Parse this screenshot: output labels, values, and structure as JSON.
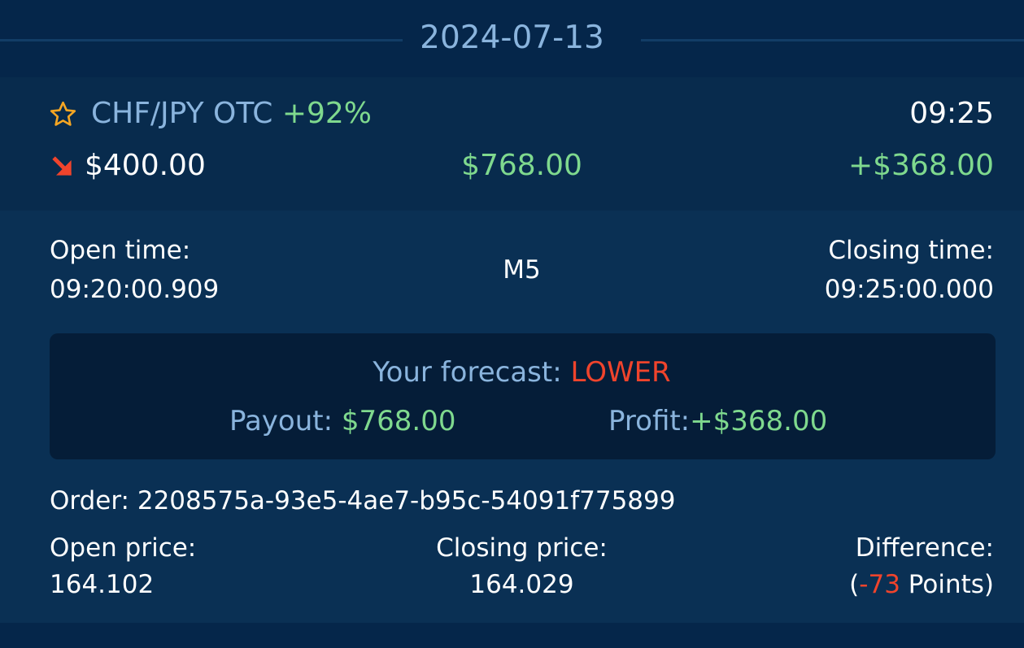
{
  "date_header": {
    "date": "2024-07-13"
  },
  "trade": {
    "asset": "CHF/JPY OTC",
    "payout_percent": "+92%",
    "close_hhmm": "09:25",
    "amount": "$400.00",
    "payout": "$768.00",
    "profit": "+$368.00",
    "direction_icon": "arrow-down-right-icon",
    "favorite_icon": "star-outline-icon"
  },
  "details": {
    "open_time_label": "Open time:",
    "open_time_value": "09:20:00.909",
    "timeframe": "M5",
    "closing_time_label": "Closing time:",
    "closing_time_value": "09:25:00.000",
    "forecast_label": "Your forecast:",
    "forecast_direction": "LOWER",
    "payout_label": "Payout:",
    "payout_value": "$768.00",
    "profit_label": "Profit:",
    "profit_value": "+$368.00",
    "order_label": "Order:",
    "order_id": "2208575a-93e5-4ae7-b95c-54091f775899",
    "open_price_label": "Open price:",
    "open_price_value": "164.102",
    "closing_price_label": "Closing price:",
    "closing_price_value": "164.029",
    "difference_label": "Difference:",
    "difference_open": "(",
    "difference_value": "-73",
    "difference_unit": " Points)"
  },
  "colors": {
    "background": "#042344",
    "summary_bg": "#082b4d",
    "details_bg": "#0a3054",
    "forecast_box_bg": "#051d38",
    "accent_blue": "#8ab4dd",
    "profit_green": "#7fd98e",
    "loss_red": "#f0442c",
    "star_orange": "#f5a623"
  }
}
